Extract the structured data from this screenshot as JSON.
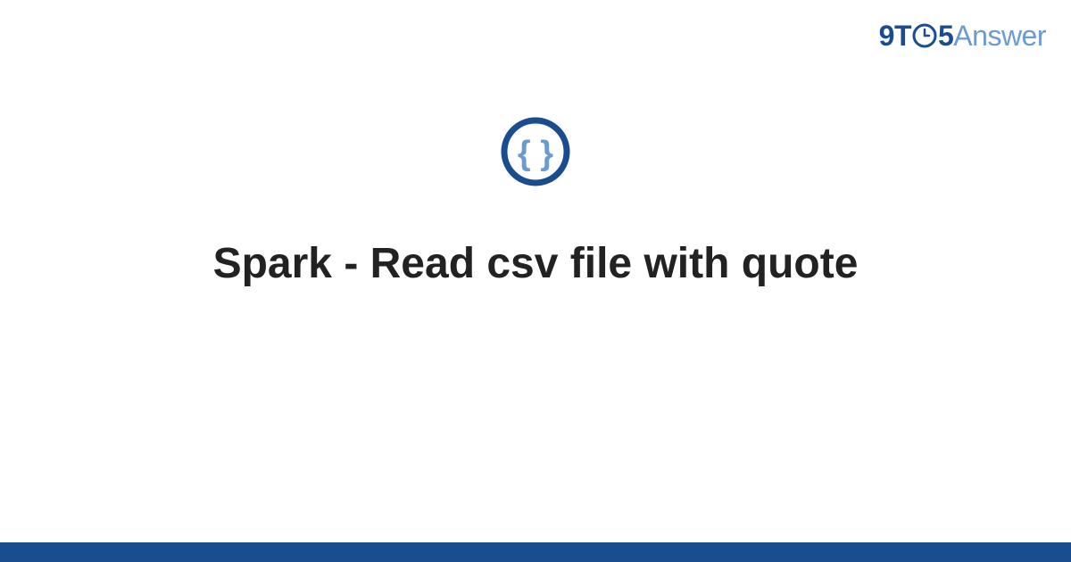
{
  "brand": {
    "part1": "9T",
    "part2": "5",
    "part3": "Answer"
  },
  "main": {
    "title": "Spark - Read csv file with quote"
  },
  "colors": {
    "primary": "#1a4d8f",
    "secondary": "#6b9bd1",
    "text": "#222222"
  }
}
